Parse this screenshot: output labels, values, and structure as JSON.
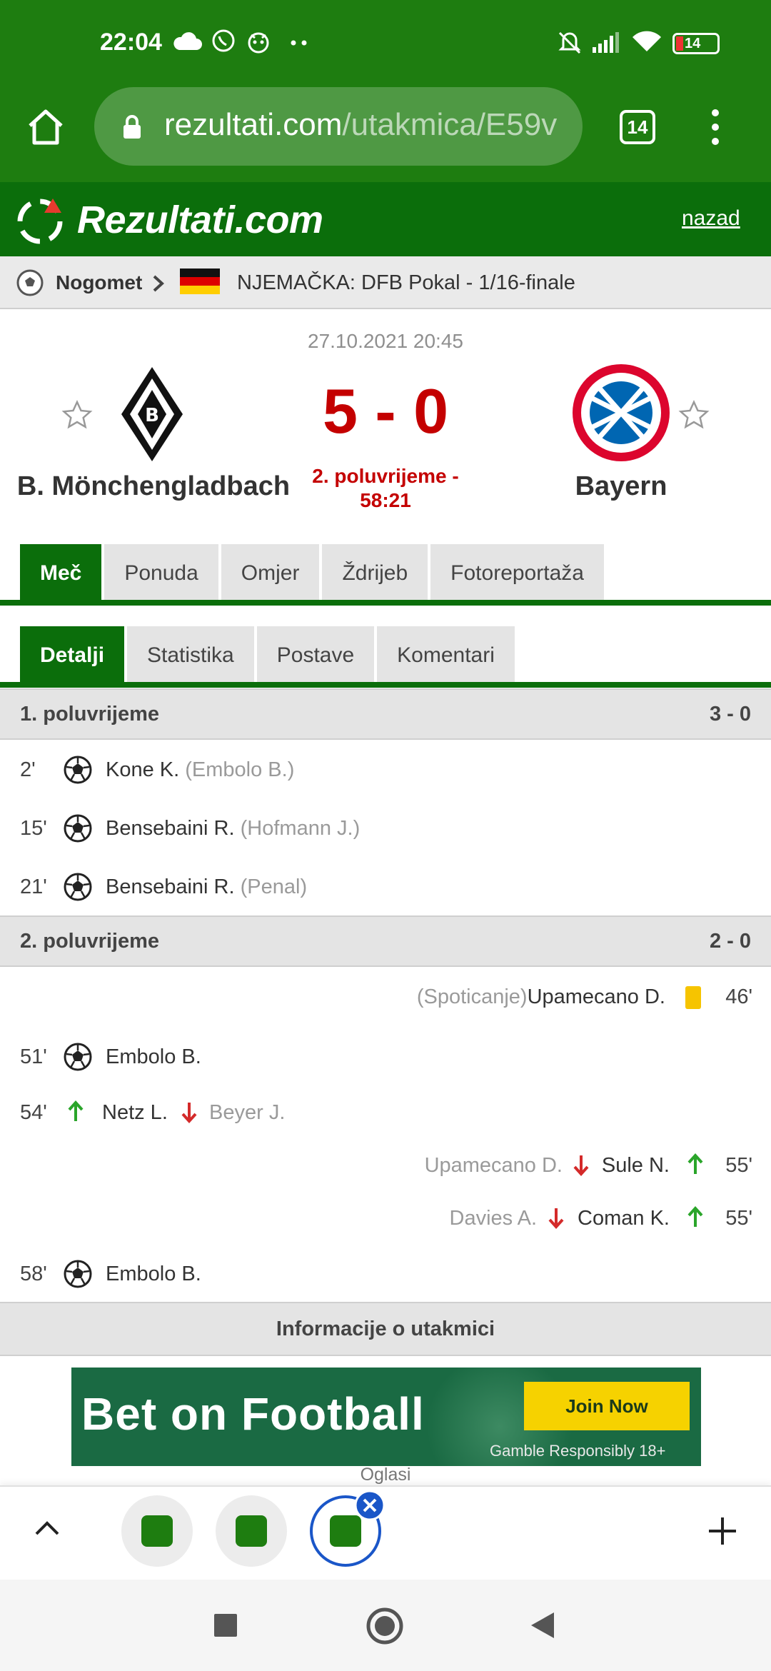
{
  "status_bar": {
    "time": "22:04",
    "battery": "14",
    "icons": [
      "cloud-icon",
      "viber-icon",
      "mascot-icon",
      "dots-icon",
      "mute-icon",
      "signal-icon",
      "wifi-icon",
      "battery-icon"
    ]
  },
  "browser": {
    "url_domain": "rezultati.com",
    "url_path": "/utakmica/E59v",
    "tab_count": "14"
  },
  "site": {
    "brand": "Rezultati.com",
    "back_link": "nazad"
  },
  "breadcrumb": {
    "sport": "Nogomet",
    "league": "NJEMAČKA: DFB Pokal - 1/16-finale"
  },
  "match": {
    "date": "27.10.2021 20:45",
    "score": "5 - 0",
    "status_line1": "2. poluvrijeme -",
    "status_line2": "58:21",
    "home_team": "B. Mönchengladbach",
    "away_team": "Bayern"
  },
  "main_tabs": [
    "Meč",
    "Ponuda",
    "Omjer",
    "Ždrijeb",
    "Fotoreportaža"
  ],
  "sub_tabs": [
    "Detalji",
    "Statistika",
    "Postave",
    "Komentari"
  ],
  "first_half": {
    "title": "1. poluvrijeme",
    "score": "3 - 0",
    "events": [
      {
        "minute": "2'",
        "player": "Kone K.",
        "detail": "(Embolo B.)"
      },
      {
        "minute": "15'",
        "player": "Bensebaini R.",
        "detail": "(Hofmann J.)"
      },
      {
        "minute": "21'",
        "player": "Bensebaini R.",
        "detail": "(Penal)"
      }
    ]
  },
  "second_half": {
    "title": "2. poluvrijeme",
    "score": "2 - 0",
    "card": {
      "minute": "46'",
      "player": "Upamecano D.",
      "detail": "(Spoticanje)"
    },
    "goal1": {
      "minute": "51'",
      "player": "Embolo B."
    },
    "sub_home": {
      "minute": "54'",
      "in": "Netz L.",
      "out": "Beyer J."
    },
    "sub_away1": {
      "minute": "55'",
      "in": "Sule N.",
      "out": "Upamecano D."
    },
    "sub_away2": {
      "minute": "55'",
      "in": "Coman K.",
      "out": "Davies A."
    },
    "goal2": {
      "minute": "58'",
      "player": "Embolo B."
    }
  },
  "info_section": "Informacije o utakmici",
  "ad": {
    "title": "Bet on Football",
    "button": "Join Now",
    "footer": "Gamble Responsibly  18+",
    "label": "Oglasi"
  },
  "colors": {
    "brand_green": "#0b6e0b",
    "status_green": "#1e7d10",
    "score_red": "#c40000"
  }
}
